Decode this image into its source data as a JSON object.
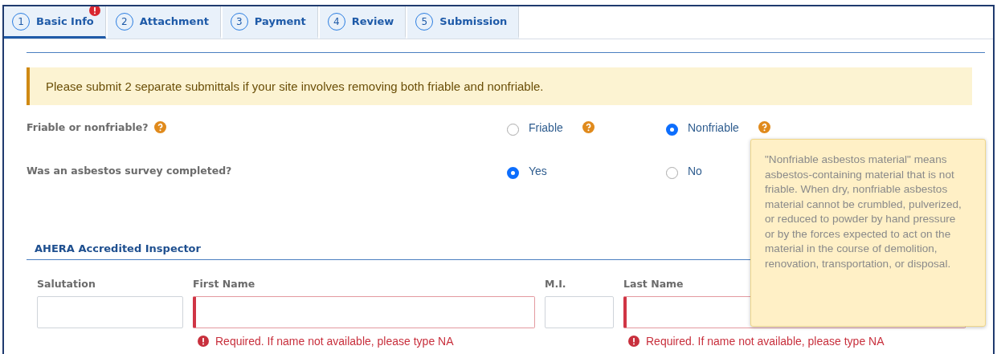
{
  "tabs": [
    {
      "number": "1",
      "label": "Basic Info",
      "selected": true,
      "error": true
    },
    {
      "number": "2",
      "label": "Attachment",
      "selected": false,
      "error": false
    },
    {
      "number": "3",
      "label": "Payment",
      "selected": false,
      "error": false
    },
    {
      "number": "4",
      "label": "Review",
      "selected": false,
      "error": false
    },
    {
      "number": "5",
      "label": "Submission",
      "selected": false,
      "error": false
    }
  ],
  "alert": "Please submit 2 separate submittals if your site involves removing both friable and nonfriable.",
  "questions": [
    {
      "label": "Friable or nonfriable?",
      "help": true,
      "options": [
        {
          "label": "Friable",
          "selected": false,
          "help": true
        },
        {
          "label": "Nonfriable",
          "selected": true,
          "help": true
        }
      ]
    },
    {
      "label": "Was an asbestos survey completed?",
      "options": [
        {
          "label": "Yes",
          "selected": true
        },
        {
          "label": "No",
          "selected": false
        }
      ]
    }
  ],
  "section": "AHERA Accredited Inspector",
  "fields": [
    {
      "label": "Salutation",
      "invalid": false
    },
    {
      "label": "First Name",
      "invalid": true,
      "error": "Required. If name not available, please type NA"
    },
    {
      "label": "M.I.",
      "invalid": false
    },
    {
      "label": "Last Name",
      "invalid": true,
      "error": "Required. If name not available, please type NA"
    }
  ],
  "tooltip": "\"Nonfriable asbestos material\" means asbestos-containing material that is not friable. When dry, nonfriable asbestos material cannot be crumbled, pulverized, or reduced to powder by hand pressure or by the forces expected to act on the material in the course of demolition, renovation, transportation, or disposal."
}
